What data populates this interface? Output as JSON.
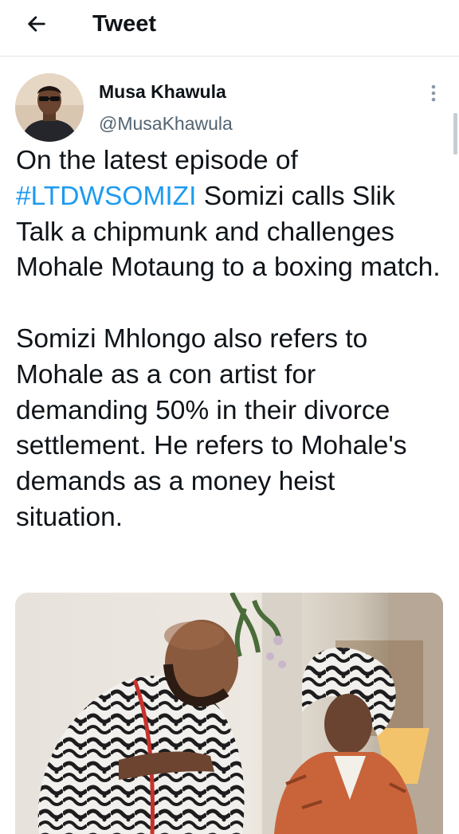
{
  "header": {
    "back_icon": "arrow-left-icon",
    "title": "Tweet"
  },
  "tweet": {
    "author": {
      "name": "Musa Khawula",
      "handle": "@MusaKhawula"
    },
    "more_icon": "more-vertical-icon",
    "paragraph1": {
      "before_hashtag": "On the latest episode of ",
      "hashtag": "#LTDWSOMIZI",
      "after_hashtag": " Somizi calls Slik Talk a chipmunk and challenges Mohale Motaung to a boxing match."
    },
    "paragraph2": "Somizi Mhlongo also refers to Mohale as a con artist for demanding 50% in their divorce settlement. He refers to Mohale's demands as a money heist situation."
  },
  "colors": {
    "link": "#1d9bf0",
    "text": "#0f1419",
    "muted": "#536471",
    "divider": "#e1e6ea"
  }
}
